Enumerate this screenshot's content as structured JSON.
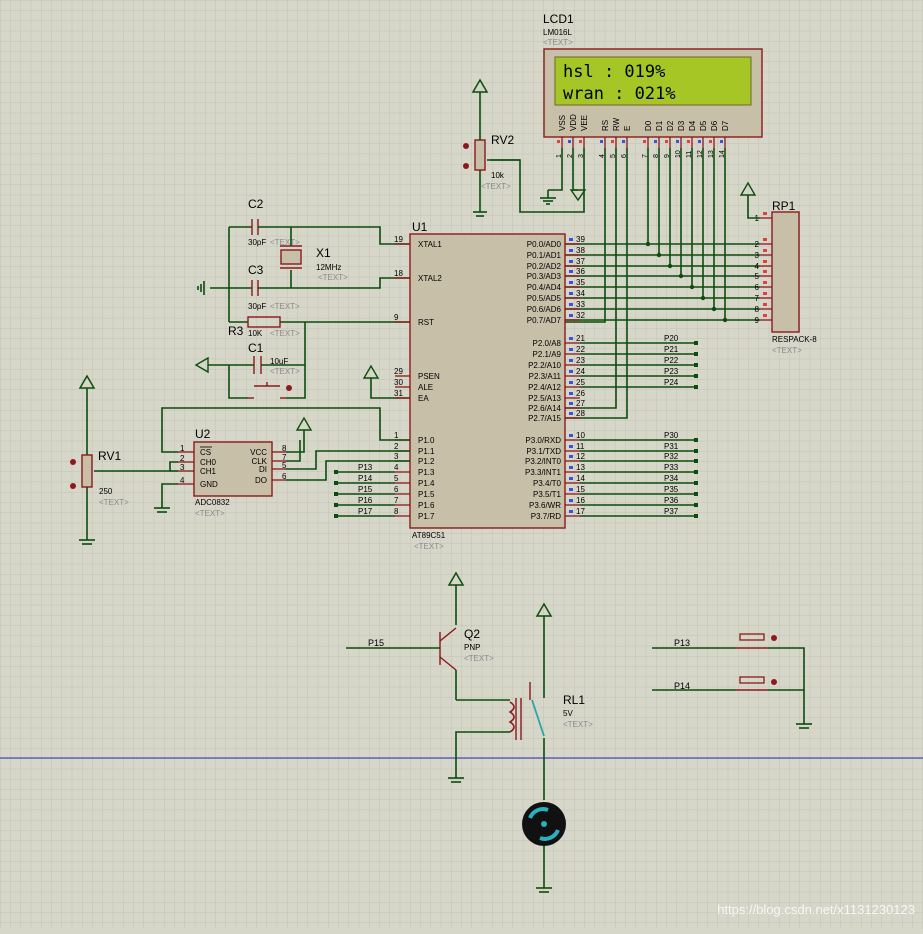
{
  "lcd": {
    "ref": "LCD1",
    "part": "LM016L",
    "text": "<TEXT>",
    "line1": "hsl   : 019%",
    "line2": "wran  : 021%",
    "pins": [
      "VSS",
      "VDD",
      "VEE",
      "RS",
      "RW",
      "E",
      "D0",
      "D1",
      "D2",
      "D3",
      "D4",
      "D5",
      "D6",
      "D7"
    ],
    "pinnums": [
      "1",
      "2",
      "3",
      "4",
      "5",
      "6",
      "7",
      "8",
      "9",
      "10",
      "11",
      "12",
      "13",
      "14"
    ]
  },
  "rv2": {
    "ref": "RV2",
    "value": "10k",
    "text": "<TEXT>"
  },
  "c2": {
    "ref": "C2",
    "value": "30pF",
    "text": "<TEXT>"
  },
  "c3": {
    "ref": "C3",
    "value": "30pF",
    "text": "<TEXT>"
  },
  "x1": {
    "ref": "X1",
    "value": "12MHz",
    "text": "<TEXT>"
  },
  "r3": {
    "ref": "R3",
    "value": "10K",
    "text": "<TEXT>"
  },
  "c1": {
    "ref": "C1",
    "value": "10uF",
    "text": "<TEXT>"
  },
  "u1": {
    "ref": "U1",
    "part": "AT89C51",
    "text": "<TEXT>",
    "left": [
      [
        "19",
        "XTAL1"
      ],
      [
        "18",
        "XTAL2"
      ],
      [
        "9",
        "RST"
      ],
      [
        "29",
        "PSEN"
      ],
      [
        "30",
        "ALE"
      ],
      [
        "31",
        "EA"
      ],
      [
        "1",
        "P1.0"
      ],
      [
        "2",
        "P1.1"
      ],
      [
        "3",
        "P1.2"
      ],
      [
        "4",
        "P1.3"
      ],
      [
        "5",
        "P1.4"
      ],
      [
        "6",
        "P1.5"
      ],
      [
        "7",
        "P1.6"
      ],
      [
        "8",
        "P1.7"
      ]
    ],
    "right": [
      [
        "39",
        "P0.0/AD0"
      ],
      [
        "38",
        "P0.1/AD1"
      ],
      [
        "37",
        "P0.2/AD2"
      ],
      [
        "36",
        "P0.3/AD3"
      ],
      [
        "35",
        "P0.4/AD4"
      ],
      [
        "34",
        "P0.5/AD5"
      ],
      [
        "33",
        "P0.6/AD6"
      ],
      [
        "32",
        "P0.7/AD7"
      ],
      [
        "21",
        "P2.0/A8"
      ],
      [
        "22",
        "P2.1/A9"
      ],
      [
        "23",
        "P2.2/A10"
      ],
      [
        "24",
        "P2.3/A11"
      ],
      [
        "25",
        "P2.4/A12"
      ],
      [
        "26",
        "P2.5/A13"
      ],
      [
        "27",
        "P2.6/A14"
      ],
      [
        "28",
        "P2.7/A15"
      ],
      [
        "10",
        "P3.0/RXD"
      ],
      [
        "11",
        "P3.1/TXD"
      ],
      [
        "12",
        "P3.2/INT0"
      ],
      [
        "13",
        "P3.3/INT1"
      ],
      [
        "14",
        "P3.4/T0"
      ],
      [
        "15",
        "P3.5/T1"
      ],
      [
        "16",
        "P3.6/WR"
      ],
      [
        "17",
        "P3.7/RD"
      ]
    ]
  },
  "p2labels": [
    "P20",
    "P21",
    "P22",
    "P23",
    "P24"
  ],
  "p3labels": [
    "P30",
    "P31",
    "P32",
    "P33",
    "P34",
    "P35",
    "P36",
    "P37"
  ],
  "p1labels": [
    "P13",
    "P14",
    "P15",
    "P16",
    "P17"
  ],
  "rp1": {
    "ref": "RP1",
    "part": "RESPACK-8",
    "text": "<TEXT>",
    "pins": [
      "1",
      "2",
      "3",
      "4",
      "5",
      "6",
      "7",
      "8",
      "9"
    ]
  },
  "u2": {
    "ref": "U2",
    "part": "ADC0832",
    "text": "<TEXT>",
    "left": [
      [
        "1",
        "CS"
      ],
      [
        "2",
        "CH0"
      ],
      [
        "3",
        "CH1"
      ],
      [
        "4",
        "GND"
      ]
    ],
    "right": [
      [
        "8",
        "VCC"
      ],
      [
        "7",
        "CLK"
      ],
      [
        "5",
        "DI"
      ],
      [
        "6",
        "DO"
      ]
    ]
  },
  "rv1": {
    "ref": "RV1",
    "value": "250",
    "text": "<TEXT>"
  },
  "q2": {
    "ref": "Q2",
    "part": "PNP",
    "text": "<TEXT>",
    "net": "P15"
  },
  "rl1": {
    "ref": "RL1",
    "value": "5V",
    "text": "<TEXT>"
  },
  "buttons": {
    "net1": "P13",
    "net2": "P14"
  },
  "watermark": "https://blog.csdn.net/x1131230123"
}
